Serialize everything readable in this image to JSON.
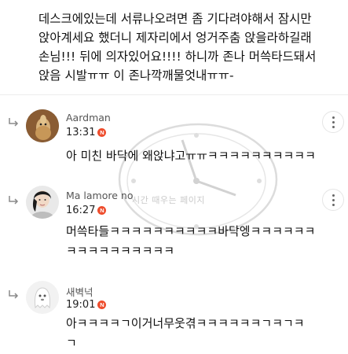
{
  "post": {
    "lines": [
      "데스크에있는데 서류나오려면 좀 기다려야해서 잠시만",
      "앉아계세요 했더니 제자리에서 엉거주춤 앉을라하길래",
      "손님!!! 뒤에 의자있어요!!!! 하니까 존나 머쓱타드돼서",
      "앉음 시발ㅠㅠ 이 존나깍깨물엇내ㅠㅠ-"
    ]
  },
  "comments": [
    {
      "author": "Aardman",
      "time": "13:31",
      "badge": "N",
      "avatar": "aardman-avatar",
      "text_lines": [
        "아 미친 바닥에 왜앉냐고ㅠㅠㅋㅋㅋㅋㅋㅋㅋㅋㅋㅋ"
      ]
    },
    {
      "author": "Ma lamore no",
      "time": "16:27",
      "badge": "N",
      "avatar": "portrait-avatar",
      "text_lines": [
        "머쓱타들ㅋㅋㅋㅋㅋㅋㅋㅋㅋㅋ바닥엥ㅋㅋㅋㅋㅋㅋ",
        "ㅋㅋㅋㅋㅋㅋㅋㅋㅋㅋ"
      ]
    },
    {
      "author": "새벽넉",
      "time": "19:01",
      "badge": "N",
      "avatar": "ghost-avatar",
      "text_lines": [
        "아ㅋㅋㅋㅋㄱ이거너무웃겪ㅋㅋㅋㅋㅋㅋㄱㅋㄱㅋ",
        "ㄱ"
      ]
    }
  ],
  "watermark": {
    "text": "시간 때우는 페이지"
  },
  "colors": {
    "badge": "#ee4d2d",
    "meta": "#555555",
    "watermark": "#c9c9c9"
  }
}
